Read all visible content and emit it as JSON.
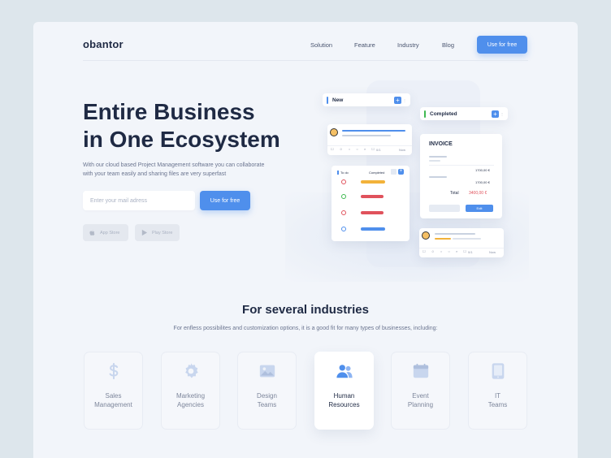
{
  "header": {
    "logo": "obantor",
    "nav": [
      "Solution",
      "Feature",
      "Industry",
      "Blog"
    ],
    "cta": "Use for free"
  },
  "hero": {
    "title_line1": "Entire Business",
    "title_line2": "in One Ecosystem",
    "desc_line1": "With our cloud based Project Management software you can collaborate",
    "desc_line2": "with your team easily and sharing files are very superfast",
    "email_placeholder": "Enter your mail adress",
    "cta": "Use for free",
    "app_store": "App Store",
    "play_store": "Play Store"
  },
  "illustration": {
    "col_new": "New",
    "col_completed": "Completed",
    "todo_label": "To do",
    "todo_completed": "Completed",
    "count_a": "0/1",
    "now": "Now",
    "invoice_title": "INVOICE",
    "invoice_row1": "1700,00 €",
    "invoice_row2": "1700,00 €",
    "total_label": "Total",
    "total_value": "3400,00 €",
    "edit": "Edit"
  },
  "colors": {
    "accent": "#4f8fec",
    "dark": "#1f2a44",
    "green": "#3fb950",
    "red": "#e0525c",
    "yellow": "#f2b23a"
  },
  "industries": {
    "title": "For several industries",
    "desc": "For enfless possibilites and customization options, it is a good fit for many types of businesses, including:",
    "items": [
      {
        "line1": "Sales",
        "line2": "Management",
        "icon": "dollar-icon"
      },
      {
        "line1": "Marketing",
        "line2": "Agencies",
        "icon": "gear-icon"
      },
      {
        "line1": "Design",
        "line2": "Teams",
        "icon": "image-icon"
      },
      {
        "line1": "Human",
        "line2": "Resources",
        "icon": "users-icon"
      },
      {
        "line1": "Event",
        "line2": "Planning",
        "icon": "calendar-icon"
      },
      {
        "line1": "IT",
        "line2": "Teams",
        "icon": "tablet-icon"
      }
    ]
  }
}
